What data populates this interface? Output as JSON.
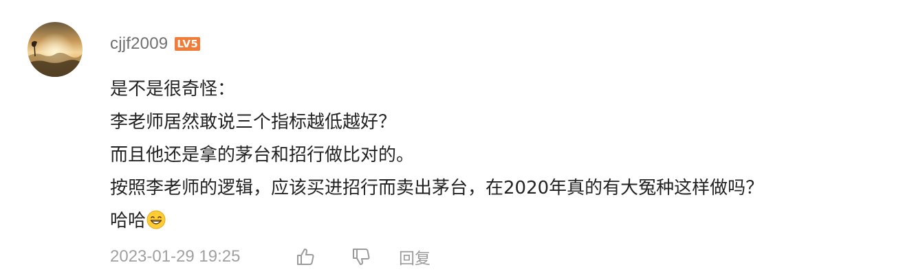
{
  "comment": {
    "user": {
      "name": "cjjf2009",
      "level_badge": "LV5",
      "avatar_icon": "sunset-landscape-avatar"
    },
    "lines": [
      "是不是很奇怪：",
      "李老师居然敢说三个指标越低越好？",
      "而且他还是拿的茅台和招行做比对的。",
      "按照李老师的逻辑，应该买进招行而卖出茅台，在2020年真的有大冤种这样做吗？",
      "哈哈"
    ],
    "trailing_emoji": "grinning-face-emoji",
    "timestamp": "2023-01-29 19:25",
    "actions": {
      "like_icon": "thumbs-up-icon",
      "dislike_icon": "thumbs-down-icon",
      "reply_label": "回复"
    }
  },
  "colors": {
    "username": "#6f6f6f",
    "badge_bg": "#f07c3a",
    "text": "#222222",
    "meta": "#a0a0a0"
  }
}
